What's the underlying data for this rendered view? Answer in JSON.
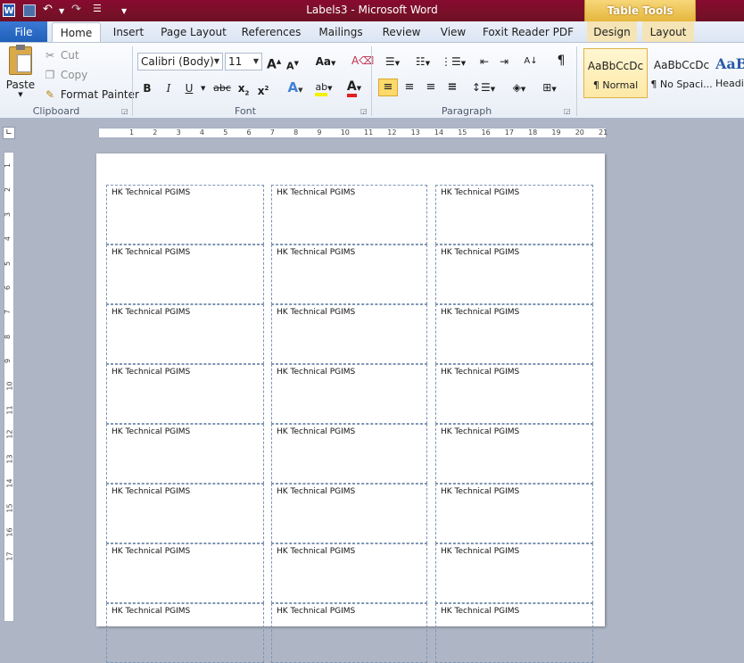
{
  "window": {
    "title": "Labels3  -  Microsoft Word",
    "table_tools": "Table Tools"
  },
  "tabs": [
    "File",
    "Home",
    "Insert",
    "Page Layout",
    "References",
    "Mailings",
    "Review",
    "View",
    "Foxit Reader PDF",
    "Design",
    "Layout"
  ],
  "clipboard": {
    "paste": "Paste",
    "cut": "Cut",
    "copy": "Copy",
    "format_painter": "Format Painter",
    "group": "Clipboard"
  },
  "font": {
    "name": "Calibri (Body)",
    "size": "11",
    "group": "Font"
  },
  "paragraph": {
    "group": "Paragraph"
  },
  "styles": [
    {
      "preview": "AaBbCcDc",
      "name": "¶ Normal"
    },
    {
      "preview": "AaBbCcDc",
      "name": "¶ No Spaci..."
    },
    {
      "preview": "AaB",
      "name": "Headi"
    }
  ],
  "ruler_h": [
    "1",
    "2",
    "3",
    "4",
    "5",
    "6",
    "7",
    "8",
    "9",
    "10",
    "11",
    "12",
    "13",
    "14",
    "15",
    "16",
    "17",
    "18",
    "19",
    "20",
    "21"
  ],
  "ruler_v": [
    "1",
    "2",
    "3",
    "4",
    "5",
    "6",
    "7",
    "8",
    "9",
    "10",
    "11",
    "12",
    "13",
    "14",
    "15",
    "16",
    "17"
  ],
  "label_text": "HK Technical PGIMS",
  "labels": [
    [
      "HK Technical PGIMS",
      "HK Technical PGIMS",
      "HK Technical PGIMS"
    ],
    [
      "HK Technical PGIMS",
      "HK Technical PGIMS",
      "HK Technical PGIMS"
    ],
    [
      "HK Technical PGIMS",
      "HK Technical PGIMS",
      "HK Technical PGIMS"
    ],
    [
      "HK Technical PGIMS",
      "HK Technical PGIMS",
      "HK Technical PGIMS"
    ],
    [
      "HK Technical PGIMS",
      "HK Technical PGIMS",
      "HK Technical PGIMS"
    ],
    [
      "HK Technical PGIMS",
      "HK Technical PGIMS",
      "HK Technical PGIMS"
    ],
    [
      "HK Technical PGIMS",
      "HK Technical PGIMS",
      "HK Technical PGIMS"
    ],
    [
      "HK Technical PGIMS",
      "HK Technical PGIMS",
      "HK Technical PGIMS"
    ]
  ]
}
